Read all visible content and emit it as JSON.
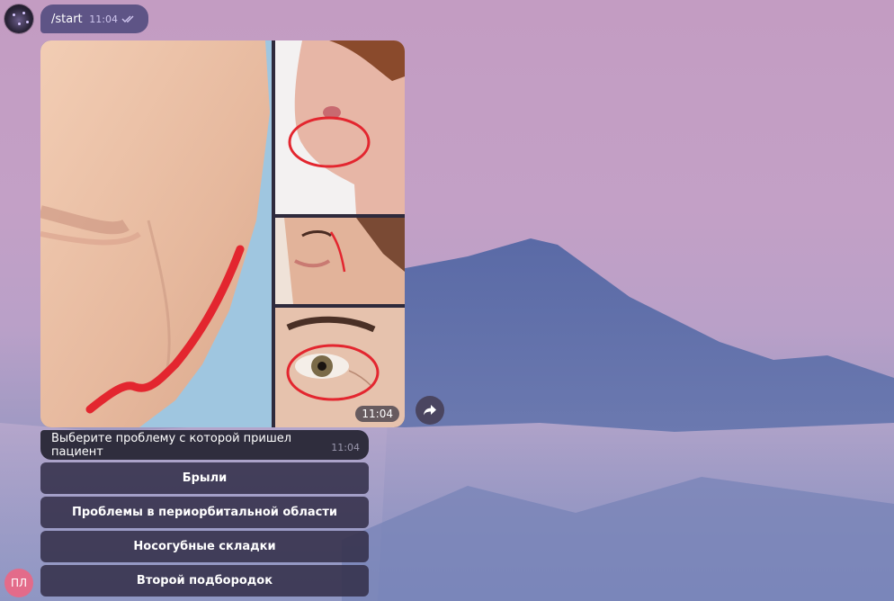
{
  "outgoing": {
    "text": "/start",
    "time": "11:04"
  },
  "album": {
    "time": "11:04"
  },
  "bot_message": {
    "text": "Выберите проблему с которой пришел пациент",
    "time": "11:04"
  },
  "keyboard": [
    {
      "label": "Брыли"
    },
    {
      "label": "Проблемы в периорбитальной области"
    },
    {
      "label": "Носогубные складки"
    },
    {
      "label": "Второй подбородок"
    }
  ],
  "bot_avatar": {
    "initials": "ПЛ",
    "color": "#e36b8a"
  },
  "colors": {
    "bubble_out": "#5e5486",
    "bubble_in": "#2f2d3d",
    "button": "#34304a",
    "marker": "#e3262f"
  },
  "icons": {
    "read": "double-check-icon",
    "share": "share-arrow-icon"
  }
}
